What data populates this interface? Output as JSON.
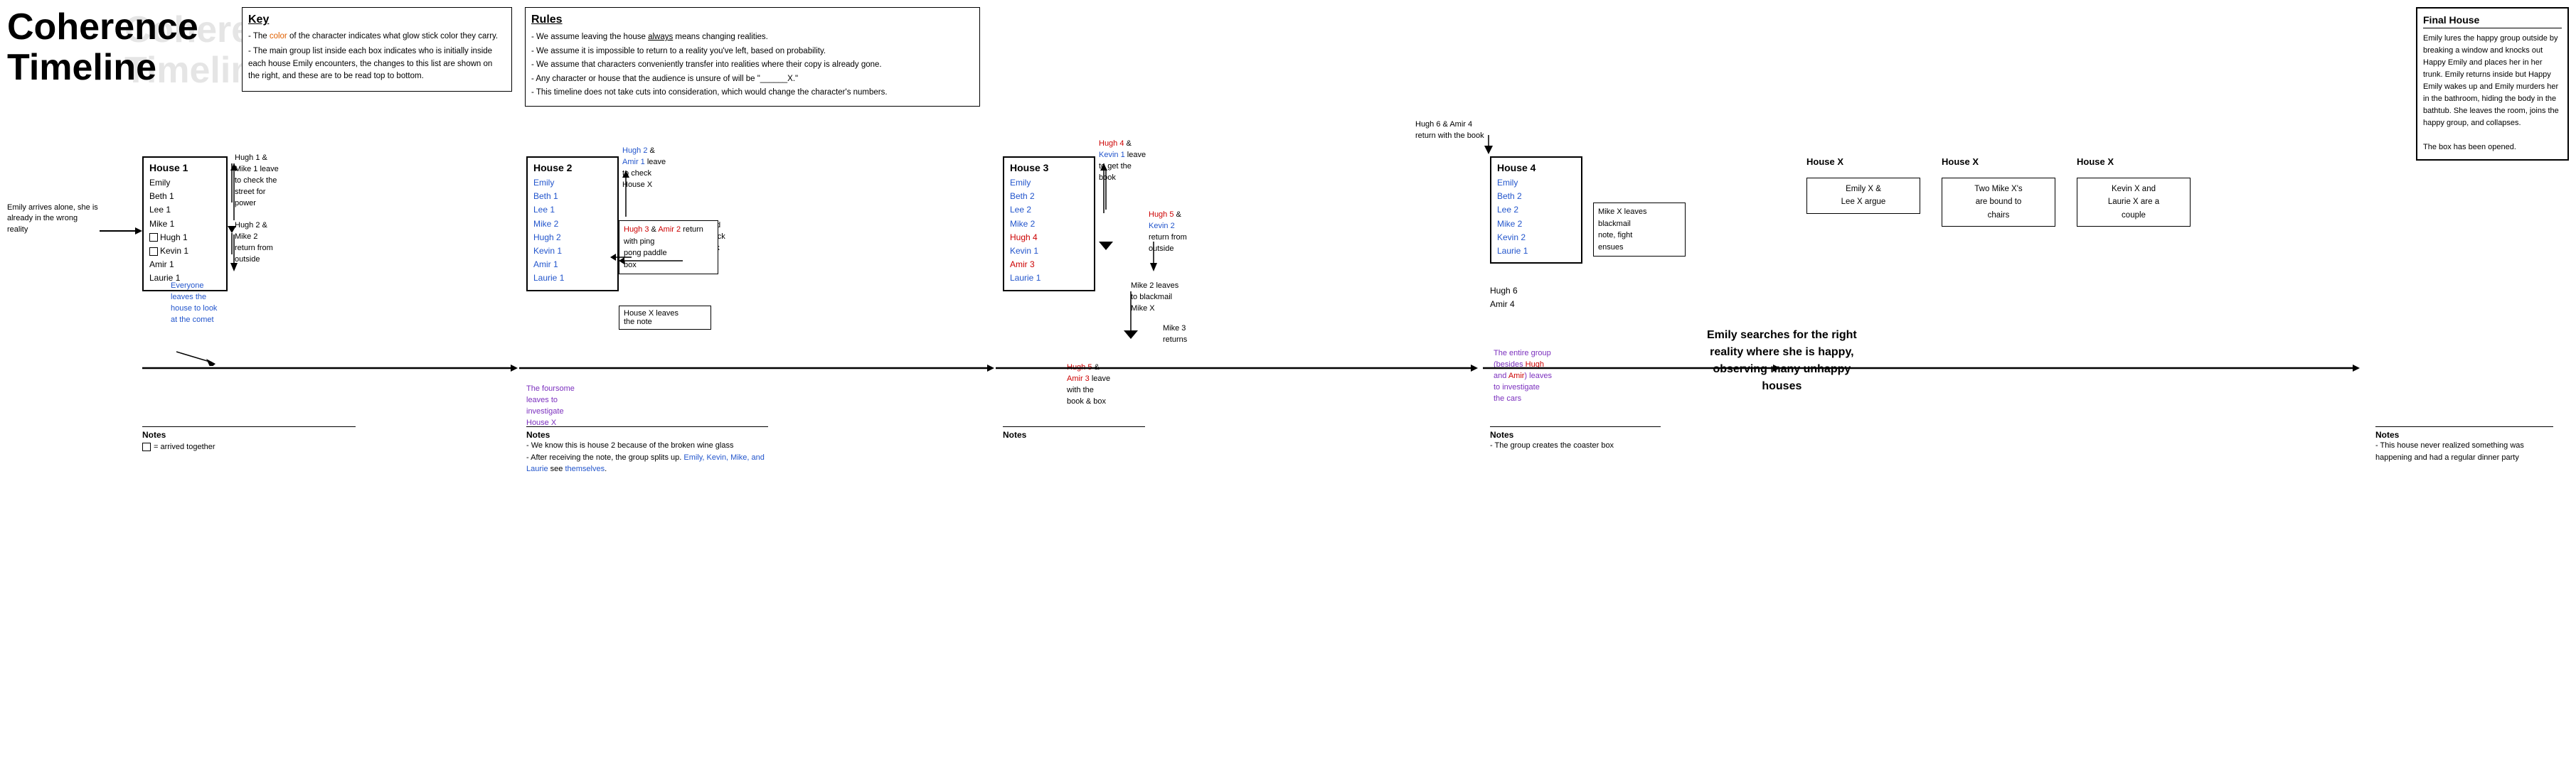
{
  "title": {
    "line1": "Coherence",
    "line2": "Timeline"
  },
  "key": {
    "heading": "Key",
    "lines": [
      "- The color of the character indicates what glow stick color they carry.",
      "- The main group list inside each box indicates who is initially inside each house Emily encounters, the changes to this list are shown on the right, and these are to be read top to bottom."
    ]
  },
  "rules": {
    "heading": "Rules",
    "items": [
      "- We assume leaving the house always means changing realities.",
      "- We assume it is impossible to return to a reality you've left, based on probability.",
      "- We assume that characters conveniently transfer into realities where their copy is already gone.",
      "- Any character or house that the audience is unsure of will be \"______X.\"",
      "- This timeline does not take cuts into consideration, which would change the character's numbers."
    ]
  },
  "final_house": {
    "title": "Final House",
    "text": "Emily lures the happy group outside by breaking a window and knocks out Happy Emily and places her in her trunk. Emily returns inside but Happy Emily wakes up and Emily murders her in the bathroom, hiding the body in the bathtub. She leaves the room, joins the happy group, and collapses.\n\nThe box has been opened."
  },
  "house1": {
    "title": "House 1",
    "note_label": "Notes",
    "note_text": "= arrived together",
    "persons": [
      "Emily",
      "Beth 1",
      "Lee 1",
      "Mike 1",
      "Hugh 1",
      "Kevin 1",
      "Amir 1",
      "Laurie 1"
    ],
    "colors": [
      "black",
      "black",
      "black",
      "black",
      "black",
      "black",
      "black",
      "black"
    ]
  },
  "house2": {
    "title": "House 2",
    "persons": [
      "Emily",
      "Beth 1",
      "Lee 1",
      "Mike 2",
      "Hugh 2",
      "Kevin 1",
      "Amir 1",
      "Laurie 1"
    ],
    "colors": [
      "blue",
      "blue",
      "blue",
      "blue",
      "blue",
      "blue",
      "blue",
      "blue"
    ],
    "note_label": "Notes",
    "note_lines": [
      "- We know this is house 2 because of the broken wine glass",
      "- After receiving the note, the group splits up. Emily, Kevin, Mike, and Laurie see themselves."
    ]
  },
  "house3": {
    "title": "House 3",
    "persons": [
      "Emily",
      "Beth 2",
      "Lee 2",
      "Mike 2",
      "Hugh 4",
      "Kevin 1",
      "Amir 3",
      "Laurie 1"
    ],
    "colors": [
      "blue",
      "blue",
      "blue",
      "blue",
      "red",
      "blue",
      "red",
      "blue"
    ],
    "note_label": "Notes"
  },
  "house4": {
    "title": "House 4",
    "persons": [
      "Emily",
      "Beth 2",
      "Lee 2",
      "Mike 2",
      "Kevin 2",
      "Laurie 1"
    ],
    "extra": [
      "Hugh 6",
      "Amir 4"
    ],
    "colors": [
      "blue",
      "blue",
      "blue",
      "blue",
      "blue",
      "blue"
    ],
    "note_label": "Notes",
    "note_text": "- The group creates the coaster box"
  },
  "houseX_1": {
    "text": "Emily X &\nLee X argue"
  },
  "houseX_2": {
    "text": "Two Mike X's\nare bound to\nchairs"
  },
  "houseX_3": {
    "text": "Kevin X and\nLaurie X are a\ncouple"
  },
  "annotations": {
    "arrives": "Emily arrives alone, she is already in the wrong reality",
    "hugh1_leave": "Hugh 1 &\nMike 1 leave\nto check the\nstreet for\npower",
    "hugh2_return": "Hugh 2 &\nMike 2\nreturn from\noutside",
    "everyone_leaves": "Everyone\nleaves the\nhouse to look\nat the comet",
    "hugh2_amir1_leave": "Hugh 2 &\nAmir 1 leave\nto check\nHouse X",
    "knock_back": "Hugh X and\nAmir X knock\non the back\ndoor",
    "hugh3_return": "Hugh 3 &\nAmir 2 return\nwith ping\npong paddle\nbox",
    "hx_leaves": "House X\nleaves the\nnote",
    "foursome_leaves": "The foursome\nleaves to\ninvestigate\nHouse X",
    "hugh4_kevin1": "Hugh 4 &\nKevin 1 leave\nto get the\nbook",
    "hugh5_kevin2": "Hugh 5 &\nKevin 2\nreturn from\noutside",
    "mike2_blackmail": "Mike 2 leaves\nto blackmail\nMike X",
    "mike3_returns": "Mike 3\nreturns",
    "hugh5_amir3": "Hugh 5 &\nAmir 3 leave\nwith the\nbook & box",
    "entire_group": "The entire group\n(besides Hugh\nand Amir) leaves\nto investigate\nthe cars",
    "hugh6_amir4": "Hugh 6 & Amir 4\nreturn with the book",
    "mike_blackmail_note": "Mike X leaves\nblackmail\nnote, fight\nensues",
    "emily_searches": "Emily searches for the right\nreality where she is happy,\nobserving many unhappy\nhouses"
  }
}
